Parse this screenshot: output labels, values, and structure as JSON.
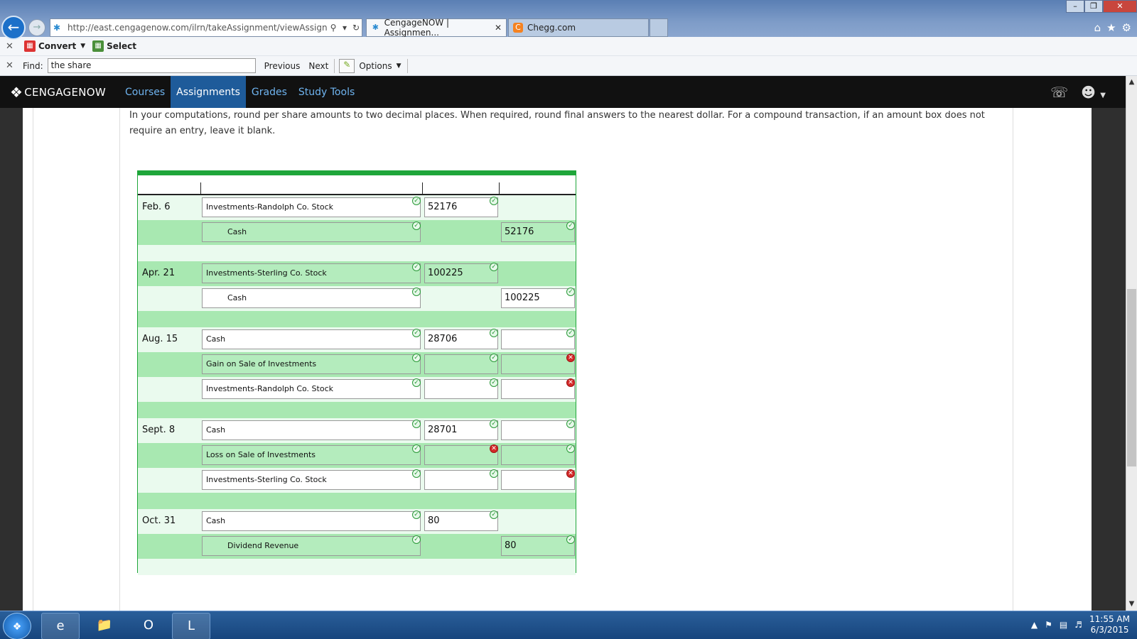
{
  "browser": {
    "address": "http://east.cengagenow.com/ilrn/takeAssignment/viewAssignment",
    "tabs": [
      {
        "label": "CengageNOW | Assignmen...",
        "active": true
      },
      {
        "label": "Chegg.com",
        "active": false
      }
    ],
    "window_controls": [
      "minimize",
      "restore",
      "close"
    ]
  },
  "toolbar": {
    "convert_label": "Convert",
    "select_label": "Select",
    "find_label": "Find:",
    "find_value": "the share",
    "previous_label": "Previous",
    "next_label": "Next",
    "options_label": "Options"
  },
  "app": {
    "logo": "CENGAGENOW",
    "nav": [
      {
        "label": "Courses",
        "active": false
      },
      {
        "label": "Assignments",
        "active": true
      },
      {
        "label": "Grades",
        "active": false
      },
      {
        "label": "Study Tools",
        "active": false
      }
    ]
  },
  "instructions": "In your computations, round per share amounts to two decimal places. When required, round final answers to the nearest dollar. For a compound transaction, if an amount box does not require an entry, leave it blank.",
  "journal": {
    "entries": [
      {
        "date": "Feb. 6",
        "lines": [
          {
            "account": "Investments-Randolph Co. Stock",
            "indent": false,
            "debit": "52176",
            "credit": null,
            "acct_ok": true,
            "debit_status": "ok",
            "credit_status": null
          },
          {
            "account": "Cash",
            "indent": true,
            "debit": null,
            "credit": "52176",
            "acct_ok": true,
            "debit_status": null,
            "credit_status": "ok"
          }
        ]
      },
      {
        "date": "Apr. 21",
        "lines": [
          {
            "account": "Investments-Sterling Co. Stock",
            "indent": false,
            "debit": "100225",
            "credit": null,
            "acct_ok": true,
            "debit_status": "ok",
            "credit_status": null
          },
          {
            "account": "Cash",
            "indent": true,
            "debit": null,
            "credit": "100225",
            "acct_ok": true,
            "debit_status": null,
            "credit_status": "ok"
          }
        ]
      },
      {
        "date": "Aug. 15",
        "lines": [
          {
            "account": "Cash",
            "indent": false,
            "debit": "28706",
            "credit": "",
            "acct_ok": true,
            "debit_status": "ok",
            "credit_status": "ok"
          },
          {
            "account": "Gain on Sale of Investments",
            "indent": false,
            "debit": "",
            "credit": "",
            "acct_ok": true,
            "debit_status": "ok",
            "credit_status": "error"
          },
          {
            "account": "Investments-Randolph Co. Stock",
            "indent": false,
            "debit": "",
            "credit": "",
            "acct_ok": true,
            "debit_status": "ok",
            "credit_status": "error"
          }
        ]
      },
      {
        "date": "Sept. 8",
        "lines": [
          {
            "account": "Cash",
            "indent": false,
            "debit": "28701",
            "credit": "",
            "acct_ok": true,
            "debit_status": "ok",
            "credit_status": "ok"
          },
          {
            "account": "Loss on Sale of Investments",
            "indent": false,
            "debit": "",
            "credit": "",
            "acct_ok": true,
            "debit_status": "error",
            "credit_status": "ok"
          },
          {
            "account": "Investments-Sterling Co. Stock",
            "indent": false,
            "debit": "",
            "credit": "",
            "acct_ok": true,
            "debit_status": "ok",
            "credit_status": "error"
          }
        ]
      },
      {
        "date": "Oct. 31",
        "lines": [
          {
            "account": "Cash",
            "indent": false,
            "debit": "80",
            "credit": null,
            "acct_ok": true,
            "debit_status": "ok",
            "credit_status": null
          },
          {
            "account": "Dividend Revenue",
            "indent": true,
            "debit": null,
            "credit": "80",
            "acct_ok": true,
            "debit_status": null,
            "credit_status": "ok"
          }
        ]
      }
    ]
  },
  "taskbar": {
    "time": "11:55 AM",
    "date": "6/3/2015"
  },
  "colors": {
    "accent_green": "#1fa63a",
    "row_green": "#a8e8b1",
    "nav_active": "#1e5b9a",
    "error_red": "#d42a2a"
  }
}
